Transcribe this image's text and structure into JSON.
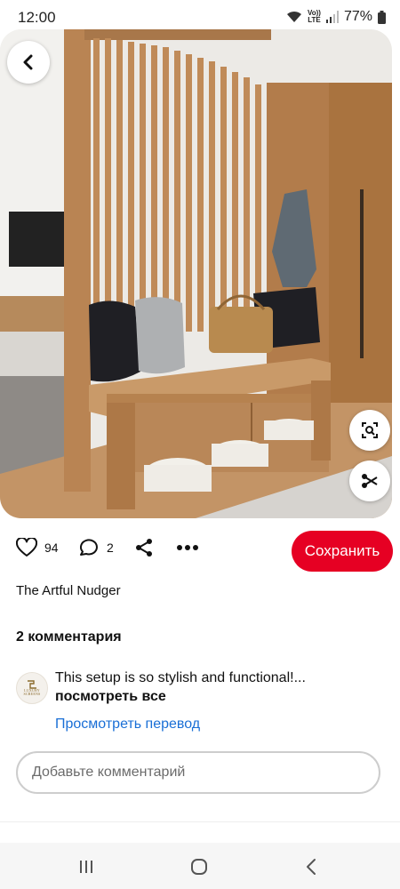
{
  "status": {
    "time": "12:00",
    "volte_top": "Vo))",
    "volte_bottom": "LTE",
    "battery": "77%"
  },
  "image": {
    "back_icon": "chevron-left-icon",
    "lens_icon": "visual-search-icon",
    "crop_icon": "scissors-icon"
  },
  "actions": {
    "like_icon": "heart-icon",
    "like_count": "94",
    "comment_icon": "comment-bubble-icon",
    "comment_count": "2",
    "share_icon": "share-icon",
    "more_icon": "more-dots-icon",
    "save_label": "Сохранить"
  },
  "pin": {
    "author": "The Artful Nudger"
  },
  "comments": {
    "heading": "2 комментария",
    "items": [
      {
        "avatar_text_top": "LUXURY",
        "avatar_text_bottom": "SCREENS",
        "text": "This setup is so stylish and functional!...",
        "more_label": "посмотреть все"
      }
    ],
    "translate_label": "Просмотреть перевод",
    "input_placeholder": "Добавьте комментарий"
  },
  "navigation": {
    "recents_icon": "recents-icon",
    "home_icon": "home-icon",
    "back_icon": "back-icon"
  },
  "colors": {
    "accent": "#e60023",
    "link": "#1a6fd6"
  }
}
